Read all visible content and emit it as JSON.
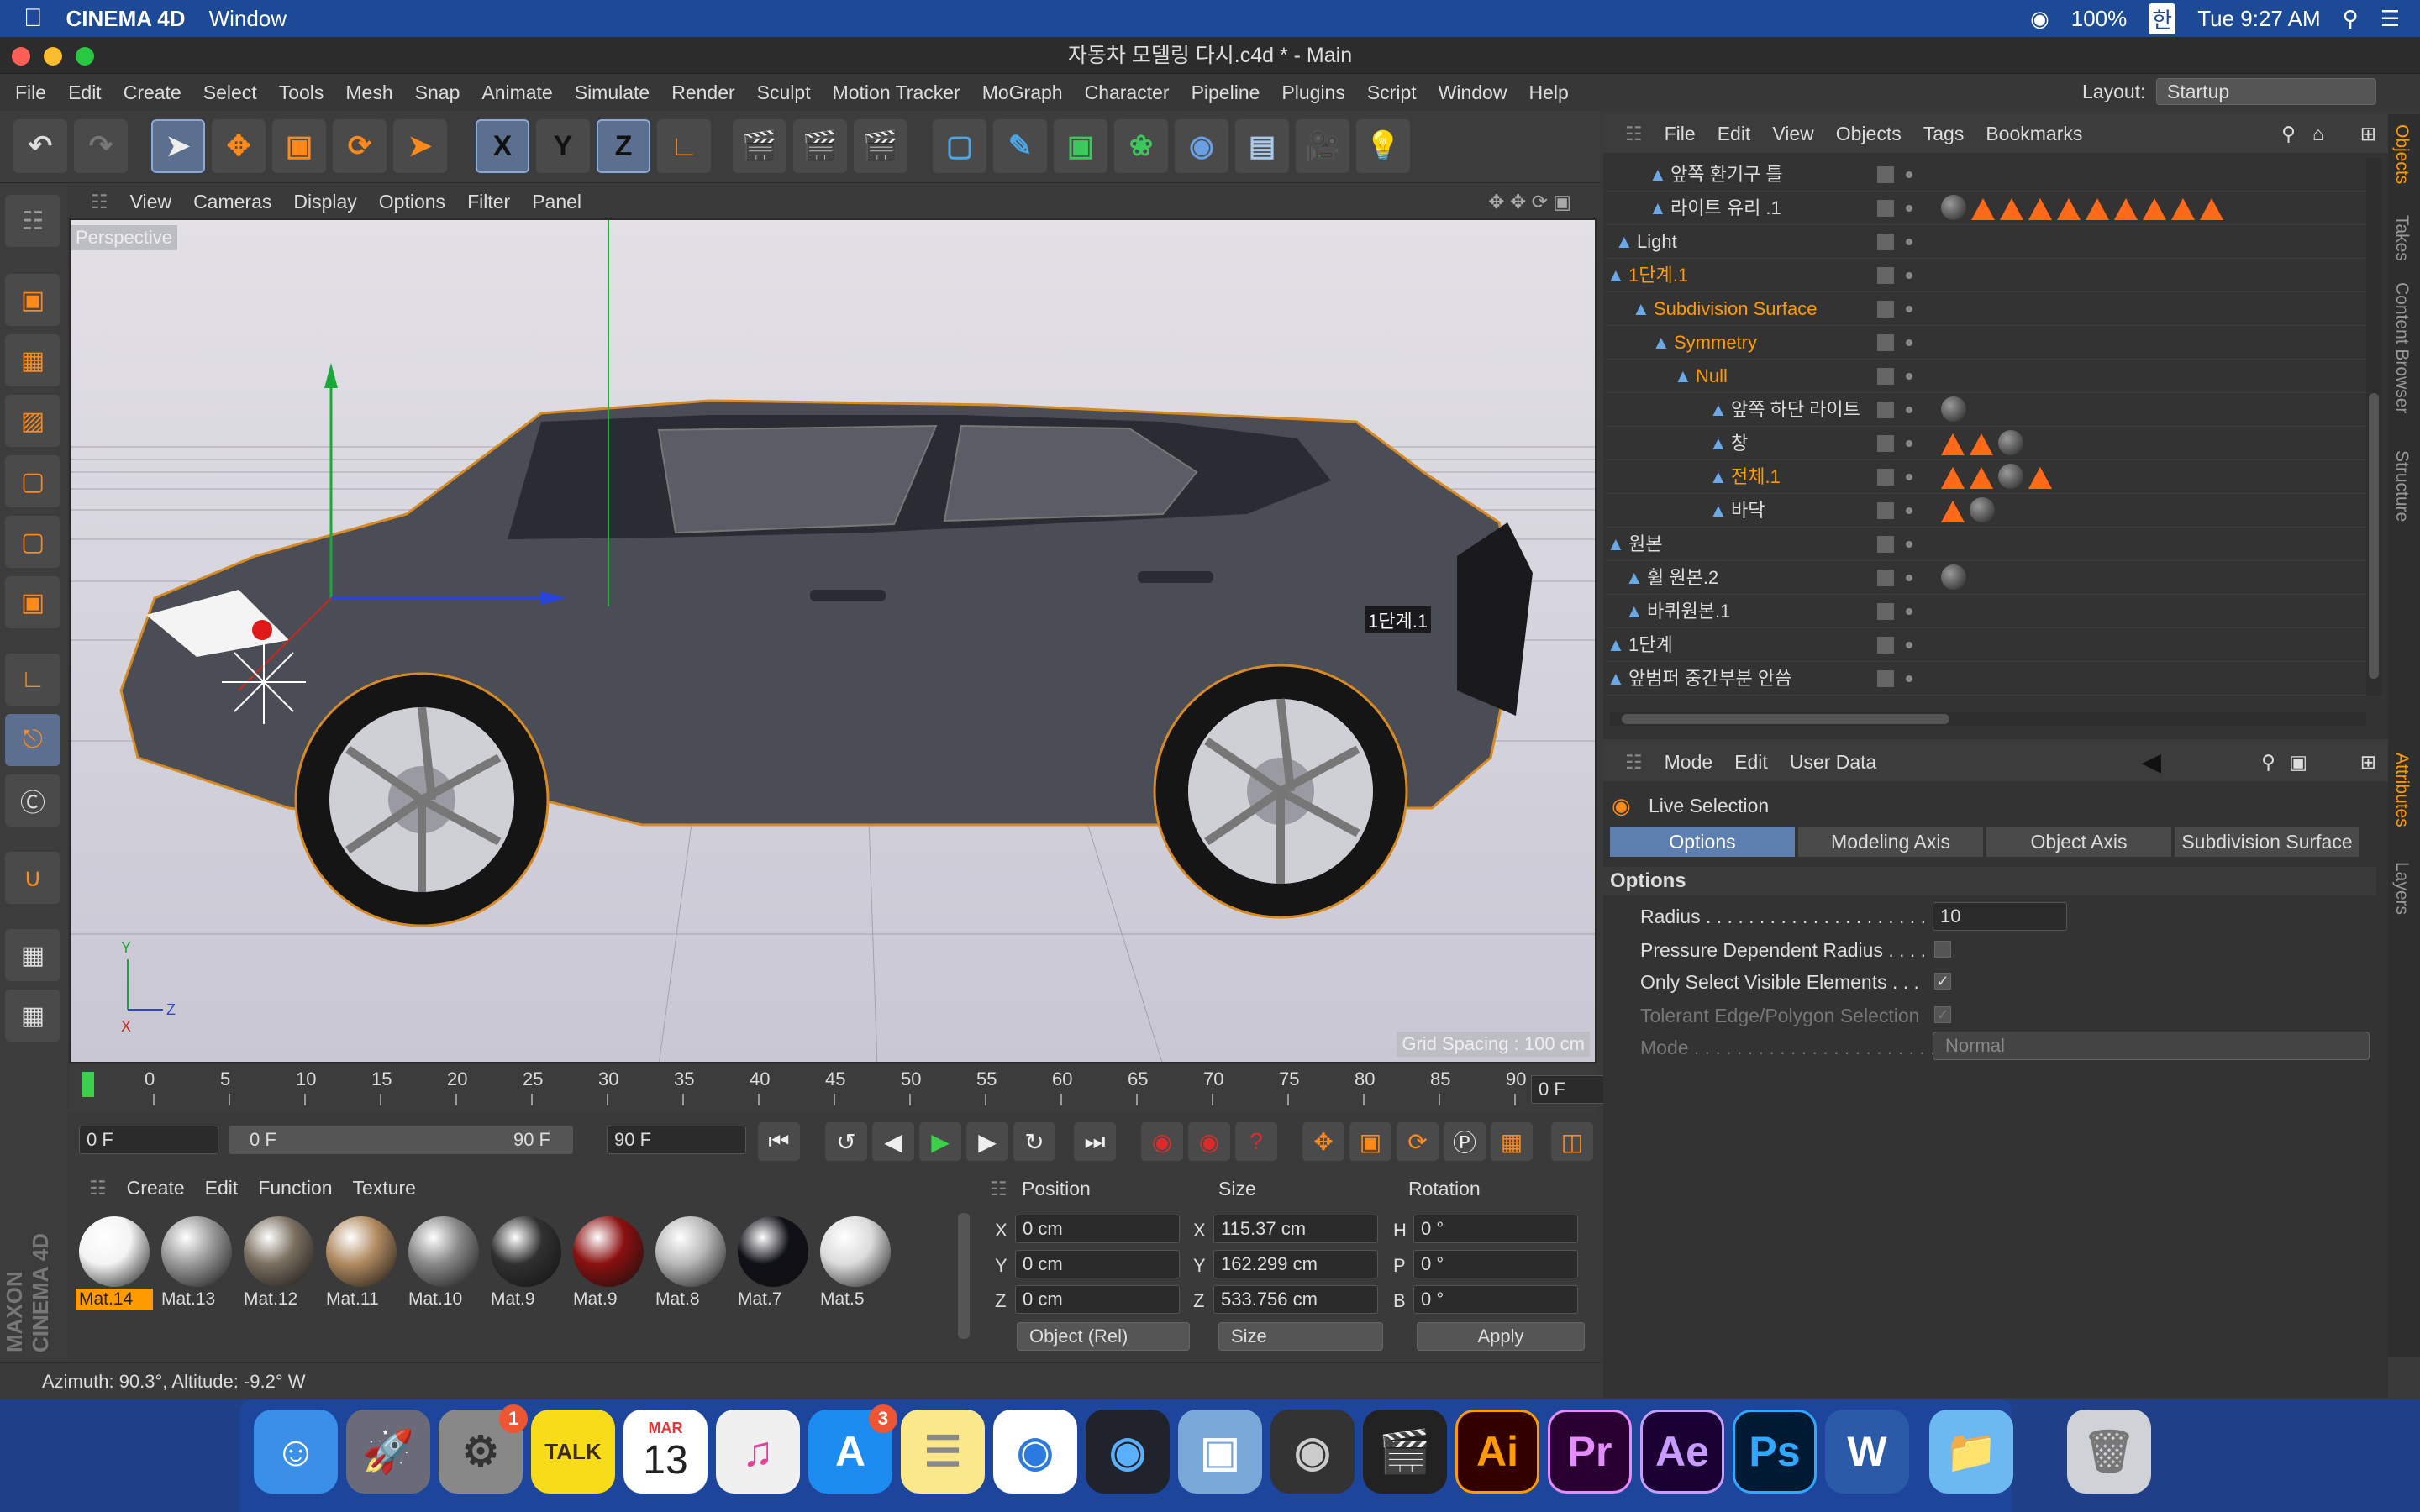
{
  "mac_menubar": {
    "app_name": "CINEMA 4D",
    "menu": "Window",
    "battery": "100%",
    "input_method": "한",
    "clock": "Tue 9:27 AM"
  },
  "window": {
    "title": "자동차 모델링 다시.c4d * - Main"
  },
  "app_menu": {
    "items": [
      "File",
      "Edit",
      "Create",
      "Select",
      "Tools",
      "Mesh",
      "Snap",
      "Animate",
      "Simulate",
      "Render",
      "Sculpt",
      "Motion Tracker",
      "MoGraph",
      "Character",
      "Pipeline",
      "Plugins",
      "Script",
      "Window",
      "Help"
    ],
    "layout_label": "Layout:",
    "layout_value": "Startup"
  },
  "toolbar": {
    "x_label": "X",
    "y_label": "Y",
    "z_label": "Z"
  },
  "viewport": {
    "menu": [
      "View",
      "Cameras",
      "Display",
      "Options",
      "Filter",
      "Panel"
    ],
    "camera_label": "Perspective",
    "grid_spacing": "Grid Spacing : 100 cm",
    "object_label": "1단계.1",
    "axis_y": "Y",
    "axis_z": "Z",
    "axis_x": "X"
  },
  "timeline": {
    "ticks": [
      "0",
      "5",
      "10",
      "15",
      "20",
      "25",
      "30",
      "35",
      "40",
      "45",
      "50",
      "55",
      "60",
      "65",
      "70",
      "75",
      "80",
      "85",
      "90"
    ],
    "current_frame": "0 F"
  },
  "playback": {
    "start": "0 F",
    "range_min": "0 F",
    "range_max": "90 F",
    "end": "90 F"
  },
  "materials": {
    "menu": [
      "Create",
      "Edit",
      "Function",
      "Texture"
    ],
    "items": [
      {
        "name": "Mat.14",
        "selected": true,
        "color": "#f4f4f4"
      },
      {
        "name": "Mat.13",
        "selected": false,
        "color": "#9a9a9a"
      },
      {
        "name": "Mat.12",
        "selected": false,
        "color": "#7a6f60"
      },
      {
        "name": "Mat.11",
        "selected": false,
        "color": "#b08a60"
      },
      {
        "name": "Mat.10",
        "selected": false,
        "color": "#888888"
      },
      {
        "name": "Mat.9",
        "selected": false,
        "color": "#303030"
      },
      {
        "name": "Mat.9",
        "selected": false,
        "color": "#8a1010"
      },
      {
        "name": "Mat.8",
        "selected": false,
        "color": "#b8b8b8"
      },
      {
        "name": "Mat.7",
        "selected": false,
        "color": "#101018"
      },
      {
        "name": "Mat.5",
        "selected": false,
        "color": "#dcdcdc"
      }
    ]
  },
  "coordinates": {
    "headers": [
      "Position",
      "Size",
      "Rotation"
    ],
    "rows": [
      {
        "axis": "X",
        "pos": "0 cm",
        "size_axis": "X",
        "size": "115.37 cm",
        "rot_axis": "H",
        "rot": "0 °"
      },
      {
        "axis": "Y",
        "pos": "0 cm",
        "size_axis": "Y",
        "size": "162.299 cm",
        "rot_axis": "P",
        "rot": "0 °"
      },
      {
        "axis": "Z",
        "pos": "0 cm",
        "size_axis": "Z",
        "size": "533.756 cm",
        "rot_axis": "B",
        "rot": "0 °"
      }
    ],
    "mode_dropdown": "Object (Rel)",
    "size_dropdown": "Size",
    "apply": "Apply"
  },
  "status": {
    "text": "Azimuth: 90.3°, Altitude: -9.2°  W"
  },
  "objects": {
    "menu": [
      "File",
      "Edit",
      "View",
      "Objects",
      "Tags",
      "Bookmarks"
    ],
    "rows": [
      {
        "name": "앞쪽 환기구 틀",
        "indent": 80,
        "orange": false
      },
      {
        "name": "라이트 유리 .1",
        "indent": 80,
        "orange": false
      },
      {
        "name": "Light",
        "indent": 40,
        "orange": false
      },
      {
        "name": "1단계.1",
        "indent": 30,
        "orange": true
      },
      {
        "name": "Subdivision Surface",
        "indent": 60,
        "orange": true
      },
      {
        "name": "Symmetry",
        "indent": 84,
        "orange": true
      },
      {
        "name": "Null",
        "indent": 110,
        "orange": true
      },
      {
        "name": "앞쪽 하단 라이트",
        "indent": 152,
        "orange": false
      },
      {
        "name": "창",
        "indent": 152,
        "orange": false
      },
      {
        "name": "전체.1",
        "indent": 152,
        "orange": true
      },
      {
        "name": "바닥",
        "indent": 152,
        "orange": false
      },
      {
        "name": "원본",
        "indent": 30,
        "orange": false
      },
      {
        "name": "휠 원본.2",
        "indent": 52,
        "orange": false
      },
      {
        "name": "바퀴원본.1",
        "indent": 52,
        "orange": false
      },
      {
        "name": "1단계",
        "indent": 30,
        "orange": false
      },
      {
        "name": "앞범퍼 중간부분 안씀",
        "indent": 30,
        "orange": false
      }
    ]
  },
  "attributes": {
    "menu": [
      "Mode",
      "Edit",
      "User Data"
    ],
    "tool_name": "Live Selection",
    "tabs": [
      "Options",
      "Modeling Axis",
      "Object Axis",
      "Subdivision Surface"
    ],
    "section": "Options",
    "radius_label": "Radius . . . . . . . . . . . . . . . . . . . . . .",
    "radius_value": "10",
    "pressure_label": "Pressure Dependent Radius . . . .",
    "visible_label": "Only Select Visible Elements . . .",
    "tolerant_label": "Tolerant Edge/Polygon Selection",
    "mode_label": "Mode . . . . . . . . . . . . . . . . . . . . . . .",
    "mode_value": "Normal",
    "checks": {
      "pressure": false,
      "visible": true,
      "tolerant": true
    }
  },
  "side_tabs": [
    "Objects",
    "Takes",
    "Content Browser",
    "Structure",
    "Attributes",
    "Layers"
  ],
  "dock": {
    "badge_prefs": "1",
    "badge_appstore": "3",
    "calendar_month": "MAR",
    "calendar_day": "13",
    "kakao": "TALK",
    "ai": "Ai",
    "pr": "Pr",
    "ae": "Ae",
    "ps": "Ps",
    "word": "W"
  }
}
